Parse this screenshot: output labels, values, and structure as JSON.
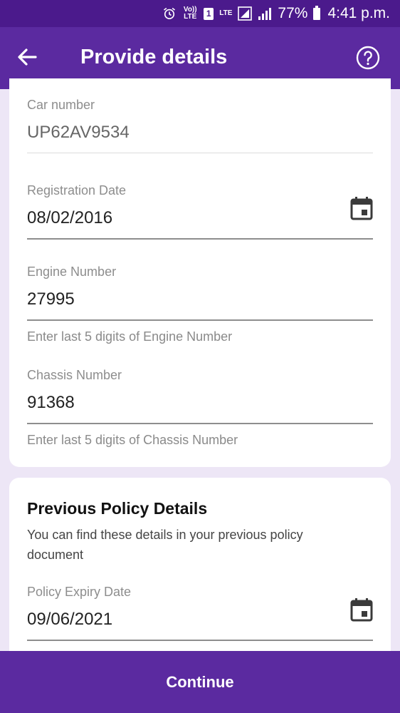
{
  "status_bar": {
    "volte_label": "Vo)) LTE",
    "sim_slot": "1",
    "network_label": "LTE",
    "battery": "77%",
    "time": "4:41 p.m.",
    "icons": [
      "alarm-icon",
      "volte-icon",
      "sim-icon",
      "lte-icon",
      "signal-icon",
      "battery-icon"
    ]
  },
  "app_bar": {
    "title": "Provide details",
    "back_icon": "arrow-back-icon",
    "help_icon": "help-circle-icon"
  },
  "vehicle_details": {
    "car_number": {
      "label": "Car number",
      "value": "UP62AV9534"
    },
    "registration_date": {
      "label": "Registration Date",
      "value": "08/02/2016",
      "icon": "calendar-icon"
    },
    "engine_number": {
      "label": "Engine Number",
      "value": "27995",
      "helper": "Enter last 5 digits of Engine Number"
    },
    "chassis_number": {
      "label": "Chassis Number",
      "value": "91368",
      "helper": "Enter last 5 digits of Chassis Number"
    }
  },
  "previous_policy": {
    "title": "Previous Policy Details",
    "description": "You can find these details in your previous policy document",
    "policy_expiry_date": {
      "label": "Policy Expiry Date",
      "value": "09/06/2021",
      "icon": "calendar-icon"
    }
  },
  "footer": {
    "continue_label": "Continue"
  },
  "colors": {
    "primary": "#5b2aa0",
    "status_bar": "#4b1a8c",
    "background": "#ede6f6"
  }
}
